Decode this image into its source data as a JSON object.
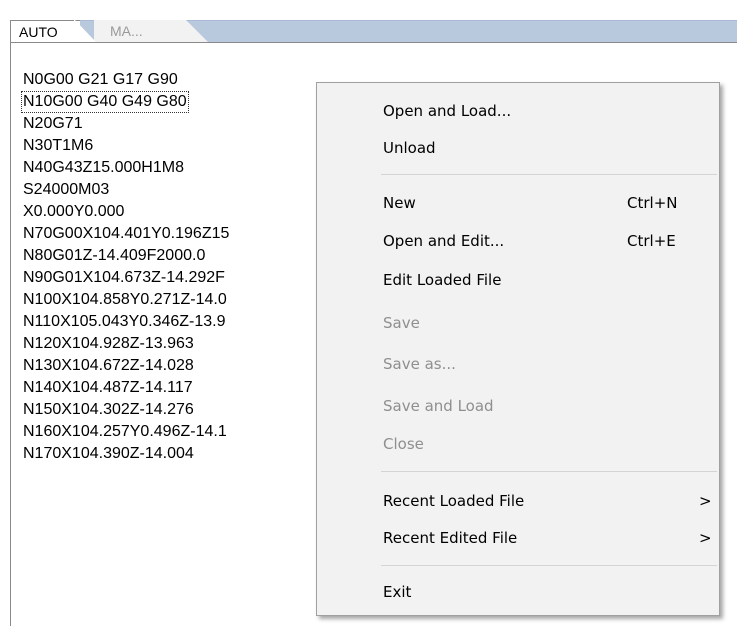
{
  "tabs": [
    {
      "label": "AUTO",
      "active": true
    },
    {
      "label": "MA...",
      "active": false
    }
  ],
  "code_lines": [
    "N0G00 G21 G17 G90",
    "N10G00 G40 G49 G80",
    "N20G71",
    "N30T1M6",
    "N40G43Z15.000H1M8",
    "S24000M03",
    "X0.000Y0.000",
    "N70G00X104.401Y0.196Z15",
    "N80G01Z-14.409F2000.0",
    "N90G01X104.673Z-14.292F",
    "N100X104.858Y0.271Z-14.0",
    "N110X105.043Y0.346Z-13.9",
    "N120X104.928Z-13.963",
    "N130X104.672Z-14.028",
    "N140X104.487Z-14.117",
    "N150X104.302Z-14.276",
    "N160X104.257Y0.496Z-14.1",
    "N170X104.390Z-14.004"
  ],
  "context_menu": {
    "open_and_load": "Open and Load...",
    "unload": "Unload",
    "new": "New",
    "new_shortcut": "Ctrl+N",
    "open_and_edit": "Open and Edit...",
    "open_and_edit_shortcut": "Ctrl+E",
    "edit_loaded_file": "Edit Loaded File",
    "save": "Save",
    "save_as": "Save as...",
    "save_and_load": "Save and Load",
    "close": "Close",
    "recent_loaded_file": "Recent Loaded File",
    "recent_edited_file": "Recent Edited File",
    "submenu_arrow": ">",
    "exit": "Exit"
  },
  "icons": {
    "submenu": "chevron-right-icon"
  },
  "colors": {
    "tab_band": "#b8c9de",
    "menu_background": "#f2f2f2",
    "disabled_text": "#8f8f8f"
  }
}
